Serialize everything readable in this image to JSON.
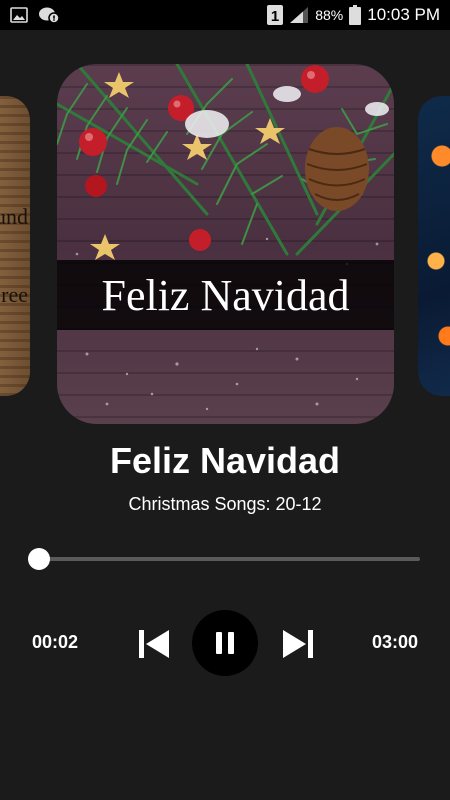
{
  "status_bar": {
    "sim_label": "1",
    "battery_percent": "88%",
    "time": "10:03 PM",
    "icons": [
      "gallery-icon",
      "chat-notification-icon",
      "sim-icon",
      "signal-icon",
      "battery-icon"
    ]
  },
  "carousel": {
    "left_art_lines": [
      "und",
      "ree"
    ],
    "main_art_title": "Feliz Navidad"
  },
  "track": {
    "title": "Feliz Navidad",
    "subtitle": "Christmas Songs: 20-12"
  },
  "player": {
    "elapsed": "00:02",
    "total": "03:00",
    "progress": 0.011,
    "state": "playing",
    "icons": [
      "skip-previous-icon",
      "pause-icon",
      "skip-next-icon"
    ]
  },
  "colors": {
    "background": "#1b1b1b",
    "status_bar": "#000000",
    "seek_track": "#5a5a5a",
    "accent": "#ffffff",
    "play_button_bg": "#000000"
  }
}
